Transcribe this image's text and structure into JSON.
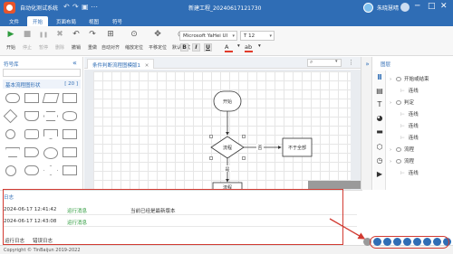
{
  "titlebar": {
    "app_title": "自动化测试系统",
    "doc_title": "新建工程_20240617121730",
    "user_name": "朱晓慧晴",
    "quick_actions": [
      "↶",
      "↷",
      "▣",
      "⋯"
    ],
    "window_buttons": [
      "─",
      "□",
      "✕"
    ]
  },
  "menubar": {
    "items": [
      {
        "label": "文件"
      },
      {
        "label": "开始",
        "active": true
      },
      {
        "label": "页面布局"
      },
      {
        "label": "视图"
      },
      {
        "label": "符号"
      }
    ]
  },
  "toolbar": {
    "buttons": [
      {
        "label": "开始",
        "icon": "▶",
        "dim": false
      },
      {
        "label": "停止",
        "icon": "■",
        "dim": true
      },
      {
        "label": "暂停",
        "icon": "❚❚",
        "dim": true
      },
      {
        "label": "删除",
        "icon": "✖",
        "dim": true
      },
      {
        "label": "撤销",
        "icon": "↶",
        "dim": false
      },
      {
        "label": "重做",
        "icon": "↷",
        "dim": false
      },
      {
        "label": "自动对齐",
        "icon": "⊞",
        "dim": false
      },
      {
        "label": "缩放定位",
        "icon": "⊙",
        "dim": false
      },
      {
        "label": "平移定位",
        "icon": "✥",
        "dim": false
      },
      {
        "label": "默认样式",
        "icon": "◎",
        "dim": false
      }
    ],
    "font_family": "Microsoft YaHei UI",
    "font_size": "12",
    "format_buttons": [
      "B",
      "I",
      "U"
    ],
    "text_color_label": "A",
    "highlight_label": "ab"
  },
  "left_panel": {
    "title": "符号库",
    "group_label": "基本流程图形状",
    "group_count": "[ 20 ]"
  },
  "doc_tab": {
    "label": "条件判断流程图模版1",
    "close": "✕"
  },
  "flowchart": {
    "start": "开始",
    "decision_1": "流程",
    "no_branch": "否",
    "action": "不于全部",
    "yes_branch": "是",
    "next": "流程"
  },
  "right_panel": {
    "title": "图层",
    "layers": [
      {
        "label": "开始或结束",
        "child": false
      },
      {
        "label": "连线",
        "child": true
      },
      {
        "label": "判定",
        "child": false
      },
      {
        "label": "连线",
        "child": true
      },
      {
        "label": "连线",
        "child": true
      },
      {
        "label": "连线",
        "child": true
      },
      {
        "label": "流程",
        "child": false
      },
      {
        "label": "流程",
        "child": false
      },
      {
        "label": "连线",
        "child": true
      }
    ]
  },
  "log": {
    "header": "日志",
    "rows": [
      {
        "time": "2024-06-17 12:41:42",
        "level": "运行消息",
        "message": "当前已经是最新版本"
      },
      {
        "time": "2024-06-17 12:43:08",
        "level": "运行消息",
        "message": ""
      }
    ],
    "tabs": [
      "运行日志",
      "错误日志"
    ]
  },
  "statusbar": {
    "copyright": "Copyright © TinBaijun 2019-2022"
  },
  "colors": {
    "brand": "#2f6db5",
    "annotation": "#d23b32",
    "log_level": "#2e9b3e"
  }
}
